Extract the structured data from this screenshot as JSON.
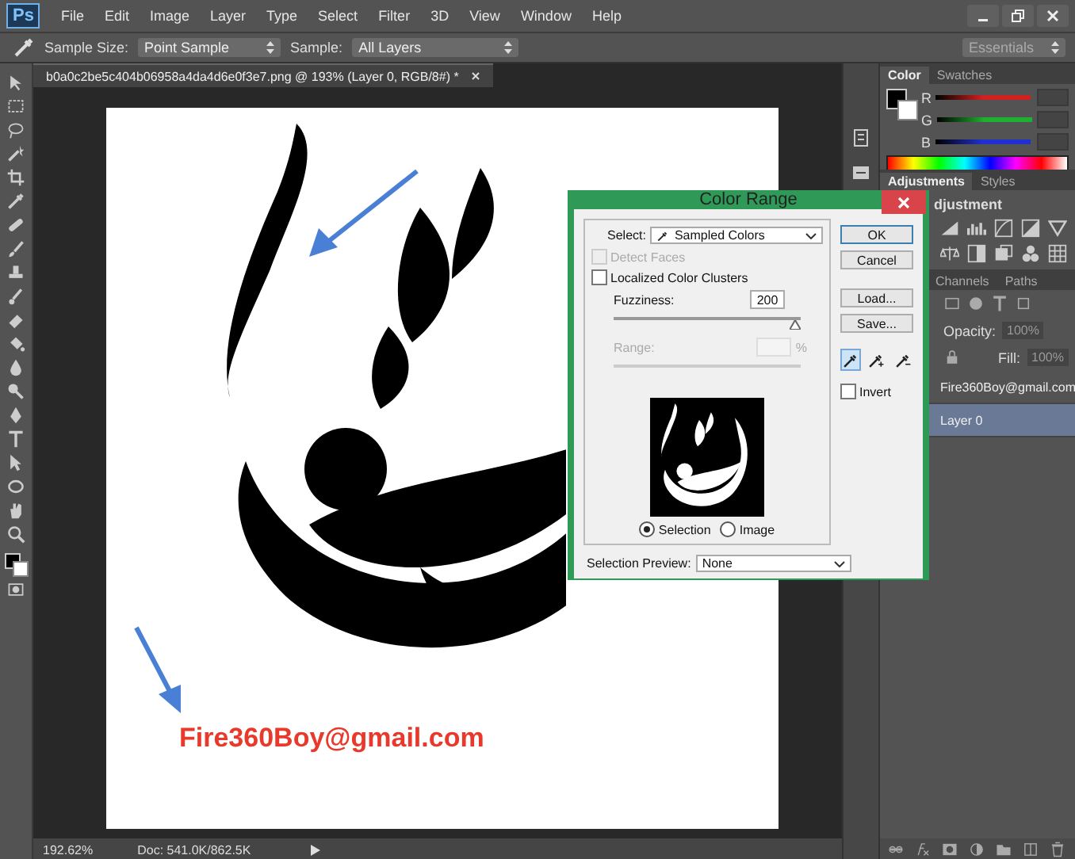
{
  "app": {
    "logo": "Ps"
  },
  "menu": [
    "File",
    "Edit",
    "Image",
    "Layer",
    "Type",
    "Select",
    "Filter",
    "3D",
    "View",
    "Window",
    "Help"
  ],
  "options": {
    "sample_size_label": "Sample Size:",
    "sample_size": "Point Sample",
    "sample_label": "Sample:",
    "sample": "All Layers",
    "workspace": "Essentials"
  },
  "document": {
    "tab_title": "b0a0c2be5c404b06958a4da4d6e0f3e7.png @ 193% (Layer 0, RGB/8#) *",
    "canvas_text": "Fire360Boy@gmail.com"
  },
  "status_bar": {
    "zoom": "192.62%",
    "doc": "Doc: 541.0K/862.5K"
  },
  "color_panel": {
    "tabs": [
      {
        "label": "Color",
        "selected": true
      },
      {
        "label": "Swatches",
        "selected": false
      }
    ],
    "channels": [
      {
        "label": "R",
        "color": "#d02020"
      },
      {
        "label": "G",
        "color": "#20b030"
      },
      {
        "label": "B",
        "color": "#2030d0"
      }
    ]
  },
  "adjustments_panel": {
    "tabs": [
      {
        "label": "Adjustments",
        "selected": true
      },
      {
        "label": "Styles",
        "selected": false
      }
    ],
    "heading": "djustment"
  },
  "layers_panel": {
    "tabs": [
      {
        "label": "Channels",
        "selected": false
      },
      {
        "label": "Paths",
        "selected": false
      }
    ],
    "opacity_label": "Opacity:",
    "opacity": "100%",
    "fill_label": "Fill:",
    "fill": "100%",
    "layers": [
      {
        "name": "Fire360Boy@gmail.com",
        "selected": false
      },
      {
        "name": "Layer 0",
        "selected": true
      }
    ]
  },
  "dialog": {
    "title": "Color Range",
    "select_label": "Select:",
    "select_value": "Sampled Colors",
    "detect_faces": {
      "label": "Detect Faces",
      "checked": false,
      "disabled": true
    },
    "localized": {
      "label": "Localized Color Clusters",
      "checked": false,
      "disabled": false
    },
    "fuzziness_label": "Fuzziness:",
    "fuzziness_value": "200",
    "fuzziness": {
      "level": 1
    },
    "range": {
      "label": "Range:",
      "unit": "%",
      "disabled": true
    },
    "buttons": [
      "OK",
      "Cancel",
      "Load...",
      "Save..."
    ],
    "eyedroppers": [
      {
        "selected": true
      },
      {
        "selected": false
      },
      {
        "selected": false
      }
    ],
    "invert": {
      "label": "Invert",
      "checked": false
    },
    "preview_modes": [
      {
        "label": "Selection",
        "selected": true
      },
      {
        "label": "Image",
        "selected": false
      }
    ],
    "selection_preview_label": "Selection Preview:",
    "selection_preview": "None"
  }
}
